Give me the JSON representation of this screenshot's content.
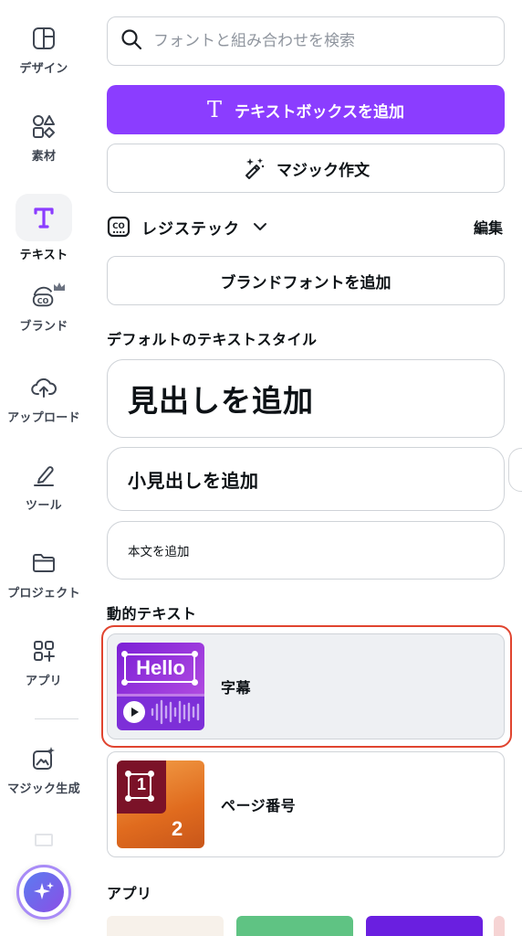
{
  "sidebar": {
    "items": [
      {
        "label": "デザイン",
        "icon": "layout-icon"
      },
      {
        "label": "素材",
        "icon": "elements-icon"
      },
      {
        "label": "テキスト",
        "icon": "text-icon"
      },
      {
        "label": "ブランド",
        "icon": "brand-icon"
      },
      {
        "label": "アップロード",
        "icon": "upload-cloud-icon"
      },
      {
        "label": "ツール",
        "icon": "draw-tool-icon"
      },
      {
        "label": "プロジェクト",
        "icon": "folder-icon"
      },
      {
        "label": "アプリ",
        "icon": "apps-icon"
      },
      {
        "label": "マジック生成",
        "icon": "magic-media-icon"
      }
    ],
    "active": "テキスト",
    "accent_color": "#8b3dff"
  },
  "search": {
    "placeholder": "フォントと組み合わせを検索",
    "value": ""
  },
  "actions": {
    "add_textbox": "テキストボックスを追加",
    "magic_write": "マジック作文",
    "add_brand_font": "ブランドフォントを追加"
  },
  "brand_kit": {
    "name": "レジステック",
    "edit": "編集"
  },
  "default_styles": {
    "title": "デフォルトのテキストスタイル",
    "heading": "見出しを追加",
    "subheading": "小見出しを追加",
    "body": "本文を追加"
  },
  "dynamic_text": {
    "title": "動的テキスト",
    "items": [
      {
        "label": "字幕",
        "thumb_text": "Hello",
        "selected": true
      },
      {
        "label": "ページ番号",
        "thumb_text_top": "1",
        "thumb_text_bottom": "2",
        "selected": false
      }
    ]
  },
  "apps": {
    "title": "アプリ"
  },
  "colors": {
    "primary": "#8b3dff",
    "highlight": "#e0442f"
  }
}
